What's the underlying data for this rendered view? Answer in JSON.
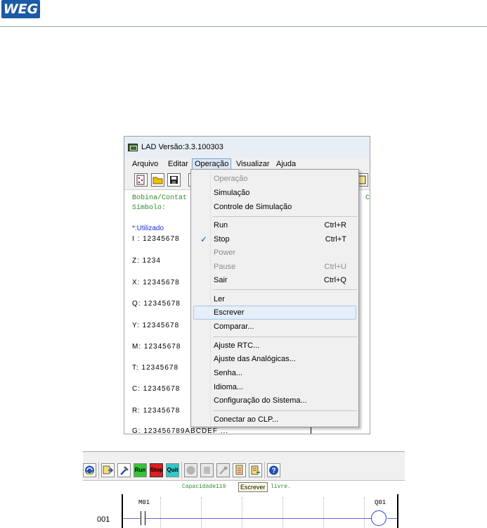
{
  "header": {
    "logo_text": "WEG"
  },
  "window": {
    "title": "LAD Versão:3.3.100303",
    "menu": [
      {
        "label": "Arquivo"
      },
      {
        "label": "Editar"
      },
      {
        "label": "Operação"
      },
      {
        "label": "Visualizar"
      },
      {
        "label": "Ajuda"
      }
    ],
    "left_panel": {
      "bobina_label": "Bobina/Contat",
      "simbolo_label": "Símbolo:",
      "used_label": "*:Utilizado",
      "io_lines": [
        "I : 12345678",
        "Z: 1234",
        "X: 12345678",
        "Q: 12345678",
        "Y: 12345678",
        "M: 12345678",
        "T: 12345678",
        "C: 12345678",
        "R: 12345678",
        "G: 123456789ABCDEF  ..."
      ],
      "right_letter": "C"
    }
  },
  "dropdown": {
    "items": [
      {
        "label": "Operação",
        "shortcut": "",
        "disabled": true
      },
      {
        "label": "Simulação",
        "shortcut": "",
        "disabled": false
      },
      {
        "label": "Controle de Simulação",
        "shortcut": "",
        "disabled": false
      },
      {
        "label": "Run",
        "shortcut": "Ctrl+R",
        "disabled": false
      },
      {
        "label": "Stop",
        "shortcut": "Ctrl+T",
        "disabled": false,
        "checked": true
      },
      {
        "label": "Power",
        "shortcut": "",
        "disabled": true
      },
      {
        "label": "Pause",
        "shortcut": "Ctrl+U",
        "disabled": true
      },
      {
        "label": "Sair",
        "shortcut": "Ctrl+Q",
        "disabled": false
      },
      {
        "label": "Ler",
        "shortcut": "",
        "disabled": false
      },
      {
        "label": "Escrever",
        "shortcut": "",
        "disabled": false,
        "highlighted": true
      },
      {
        "label": "Comparar...",
        "shortcut": "",
        "disabled": false
      },
      {
        "label": "Ajuste RTC...",
        "shortcut": "",
        "disabled": false
      },
      {
        "label": "Ajuste das Analógicas...",
        "shortcut": "",
        "disabled": false
      },
      {
        "label": "Senha...",
        "shortcut": "",
        "disabled": false
      },
      {
        "label": "Idioma...",
        "shortcut": "",
        "disabled": false
      },
      {
        "label": "Configuração do Sistema...",
        "shortcut": "",
        "disabled": false
      },
      {
        "label": "Conectar ao CLP...",
        "shortcut": "",
        "disabled": false
      }
    ]
  },
  "bottom": {
    "toolbar_buttons": [
      "Run",
      "Stop",
      "Quit"
    ],
    "capacity_text": "Capacidade119",
    "capacity_tail": "o livre.",
    "tooltip": "Escrever",
    "rung_number": "001",
    "contact_label": "M01",
    "coil_label": "Q01"
  },
  "colors": {
    "weg_blue": "#1b5aa6",
    "green_text": "#2e8b2e",
    "blue_text": "#1a2ed0",
    "highlight": "#e5eef9"
  }
}
